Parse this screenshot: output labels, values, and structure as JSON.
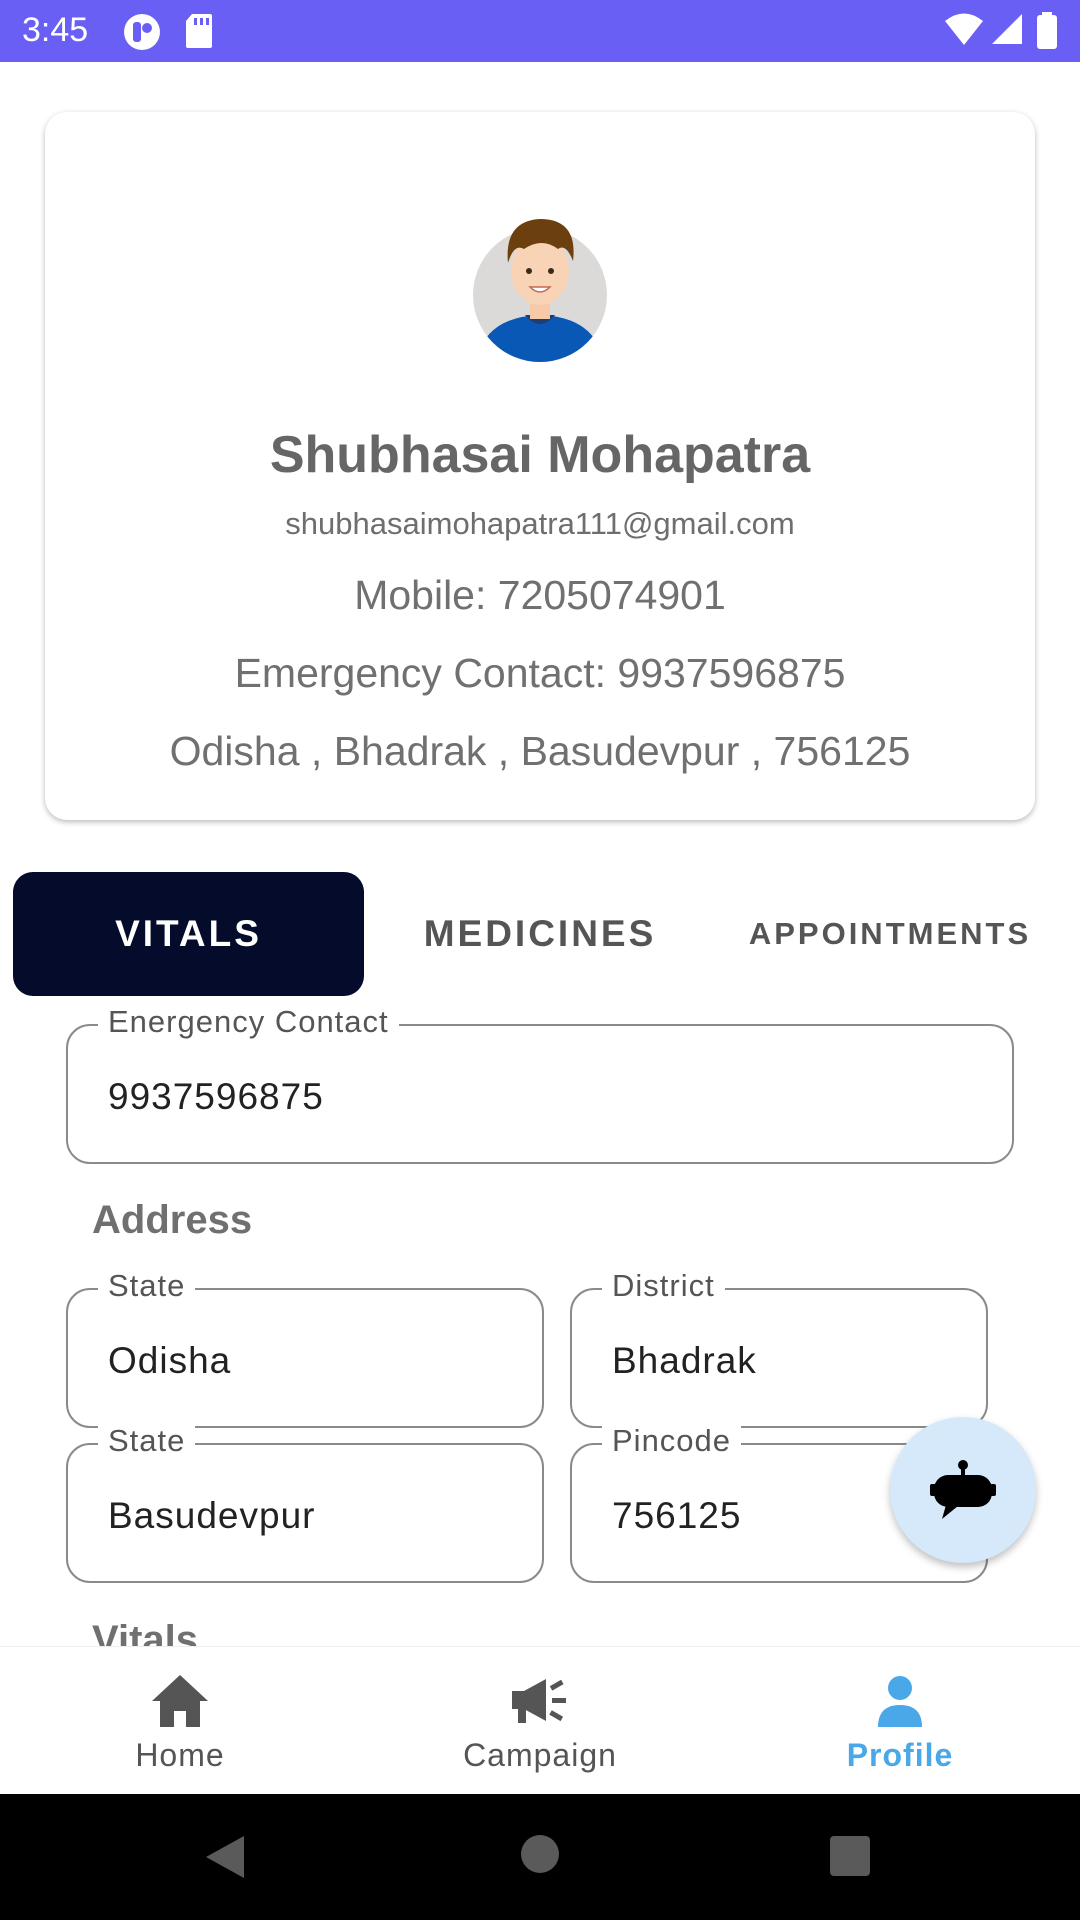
{
  "status_bar": {
    "time": "3:45"
  },
  "profile": {
    "name": "Shubhasai Mohapatra",
    "email": "shubhasaimohapatra111@gmail.com",
    "mobile": "Mobile: 7205074901",
    "emergency_contact": "Emergency Contact: 9937596875",
    "address": "Odisha , Bhadrak , Basudevpur , 756125"
  },
  "tabs": [
    {
      "label": "VITALS",
      "selected": true
    },
    {
      "label": "MEDICINES",
      "selected": false
    },
    {
      "label": "APPOINTMENTS",
      "selected": false
    }
  ],
  "form": {
    "emergency_contact": {
      "label": "Energency Contact",
      "value": "9937596875"
    },
    "address_title": "Address",
    "state": {
      "label": "State",
      "value": "Odisha"
    },
    "district": {
      "label": "District",
      "value": "Bhadrak"
    },
    "city": {
      "label": "State",
      "value": "Basudevpur"
    },
    "pincode": {
      "label": "Pincode",
      "value": "756125"
    },
    "vitals_title": "Vitals"
  },
  "bottom_nav": [
    {
      "label": "Home",
      "icon": "home-icon",
      "active": false
    },
    {
      "label": "Campaign",
      "icon": "megaphone-icon",
      "active": false
    },
    {
      "label": "Profile",
      "icon": "person-icon",
      "active": true
    }
  ],
  "fab": {
    "icon": "chatbot-icon"
  },
  "colors": {
    "status_bar": "#6a5ff5",
    "tab_selected_bg": "#050b2b",
    "nav_active": "#4aa8e8",
    "fab_bg": "#d6e9fb"
  }
}
